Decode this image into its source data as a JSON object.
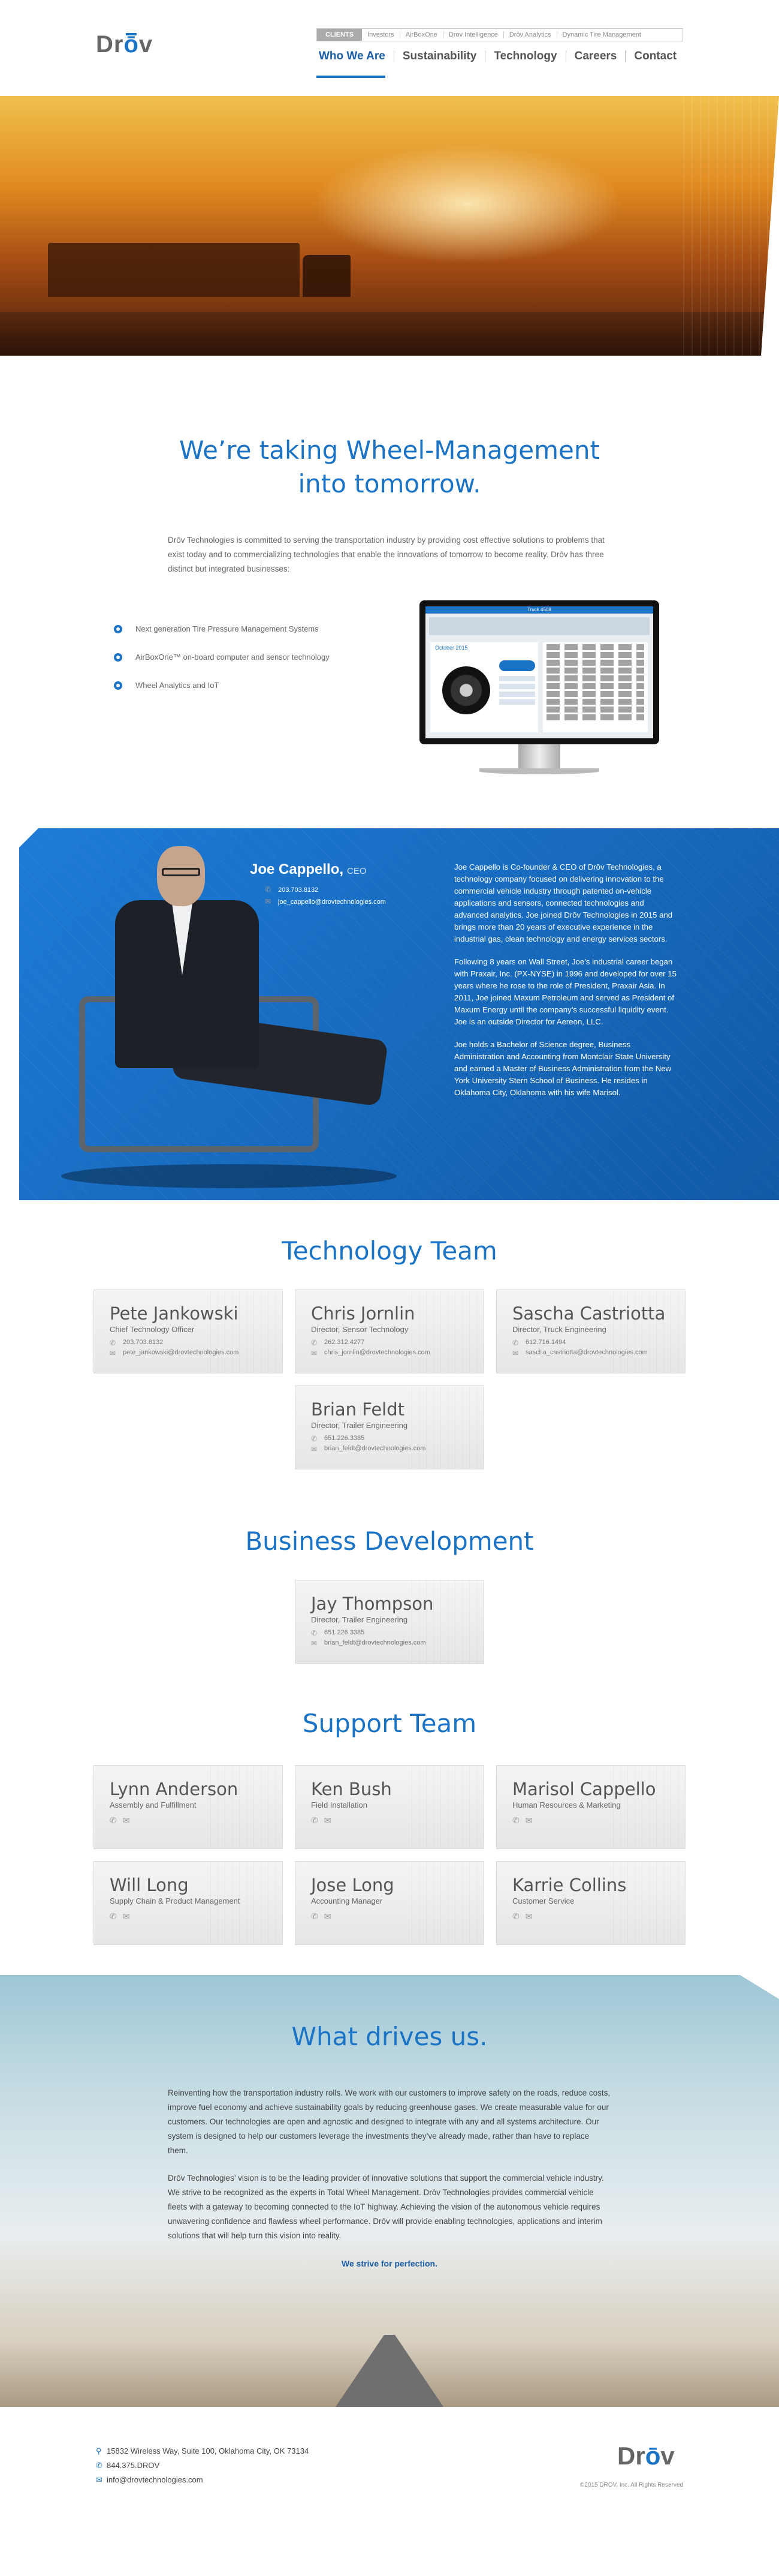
{
  "brand": {
    "logo_text_pre": "Dr",
    "logo_text_o": "ō",
    "logo_text_post": "v"
  },
  "top_links": [
    "CLIENTS",
    "Investors",
    "AirBoxOne",
    "Drov Intelligence",
    "Drōv Analytics",
    "Dynamic Tire Management"
  ],
  "nav": [
    "Who We Are",
    "Sustainability",
    "Technology",
    "Careers",
    "Contact"
  ],
  "intro": {
    "heading_line1": "We’re taking Wheel-Management",
    "heading_line2": "into tomorrow.",
    "body": "Drōv Technologies is committed to serving the transportation industry by providing cost effective solutions to problems that exist today and to commercializing technologies that enable the innovations of tomorrow to become reality. Drōv has three distinct but integrated businesses:"
  },
  "features": [
    "Next generation Tire Pressure Management Systems",
    "AirBoxOne™ on-board computer and sensor technology",
    "Wheel Analytics and IoT"
  ],
  "monitor": {
    "header": "Truck 4508",
    "date": "October 2015"
  },
  "ceo": {
    "name": "Joe Cappello,",
    "title": "CEO",
    "phone": "203.703.8132",
    "email": "joe_cappello@drovtechnologies.com",
    "bio": [
      "Joe Cappello is Co-founder & CEO of Drōv Technologies, a technology company focused on delivering innovation to the commercial vehicle industry through patented on-vehicle applications and sensors, connected technologies and advanced analytics. Joe joined Drōv Technologies in 2015 and brings more than 20 years of executive experience in the industrial gas, clean technology and energy services sectors.",
      "Following 8 years on Wall Street, Joe’s industrial career began with Praxair, Inc. (PX-NYSE) in 1996 and developed for over 15 years where he rose to the role of President, Praxair Asia. In 2011, Joe joined Maxum Petroleum and served as President of Maxum Energy until the company’s successful liquidity event. Joe is an outside Director for Aereon, LLC.",
      "Joe holds a Bachelor of Science degree, Business Administration and Accounting from Montclair State University and earned a Master of Business Administration from the New York University Stern School of Business. He resides in Oklahoma City, Oklahoma with his wife Marisol."
    ]
  },
  "tech_team": {
    "title": "Technology Team",
    "members": [
      {
        "name": "Pete Jankowski",
        "role": "Chief Technology Officer",
        "phone": "203.703.8132",
        "email": "pete_jankowski@drovtechnologies.com"
      },
      {
        "name": "Chris Jornlin",
        "role": "Director, Sensor Technology",
        "phone": "262.312.4277",
        "email": "chris_jornlin@drovtechnologies.com"
      },
      {
        "name": "Sascha Castriotta",
        "role": "Director, Truck Engineering",
        "phone": "612.716.1494",
        "email": "sascha_castriotta@drovtechnologies.com"
      },
      {
        "name": "Brian Feldt",
        "role": "Director, Trailer Engineering",
        "phone": "651.226.3385",
        "email": "brian_feldt@drovtechnologies.com"
      }
    ]
  },
  "bizdev": {
    "title": "Business Development",
    "members": [
      {
        "name": "Jay Thompson",
        "role": "Director, Trailer Engineering",
        "phone": "651.226.3385",
        "email": "brian_feldt@drovtechnologies.com"
      }
    ]
  },
  "support_team": {
    "title": "Support Team",
    "members": [
      {
        "name": "Lynn Anderson",
        "role": "Assembly and Fulfillment"
      },
      {
        "name": "Ken Bush",
        "role": "Field Installation"
      },
      {
        "name": "Marisol Cappello",
        "role": "Human Resources & Marketing"
      },
      {
        "name": "Will Long",
        "role": "Supply Chain & Product Management"
      },
      {
        "name": "Jose Long",
        "role": "Accounting Manager"
      },
      {
        "name": "Karrie Collins",
        "role": "Customer Service"
      }
    ]
  },
  "drives": {
    "title": "What drives us.",
    "p1": "Reinventing how the transportation industry rolls.  We work with our customers to improve safety on the roads, reduce costs, improve fuel economy and achieve sustainability goals by reducing greenhouse gases.  We create measurable value for our customers.  Our technologies are open and agnostic and designed to integrate with any and all systems architecture.  Our system is designed to help our customers leverage the investments they’ve already made, rather than have to replace them.",
    "p2": "Drōv Technologies’ vision is to be the leading provider of innovative solutions that support the commercial vehicle industry.  We strive to be recognized as the experts in Total Wheel Management.  Drōv Technologies provides commercial vehicle fleets with a gateway to becoming connected to the IoT highway.  Achieving the vision of the autonomous vehicle requires unwavering confidence and flawless wheel performance.  Drōv will provide enabling technologies, applications and interim solutions that will help turn this vision into reality.",
    "strive": "We strive for perfection."
  },
  "footer": {
    "address": "15832 Wireless Way, Suite 100, Oklahoma City, OK 73134",
    "phone": "844.375.DROV",
    "email": "info@drovtechnologies.com",
    "copyright": "©2015 DROV, Inc. All Rights Reserved"
  },
  "colors": {
    "accent": "#1a73c4",
    "ceo_bg": "#1567bf"
  }
}
